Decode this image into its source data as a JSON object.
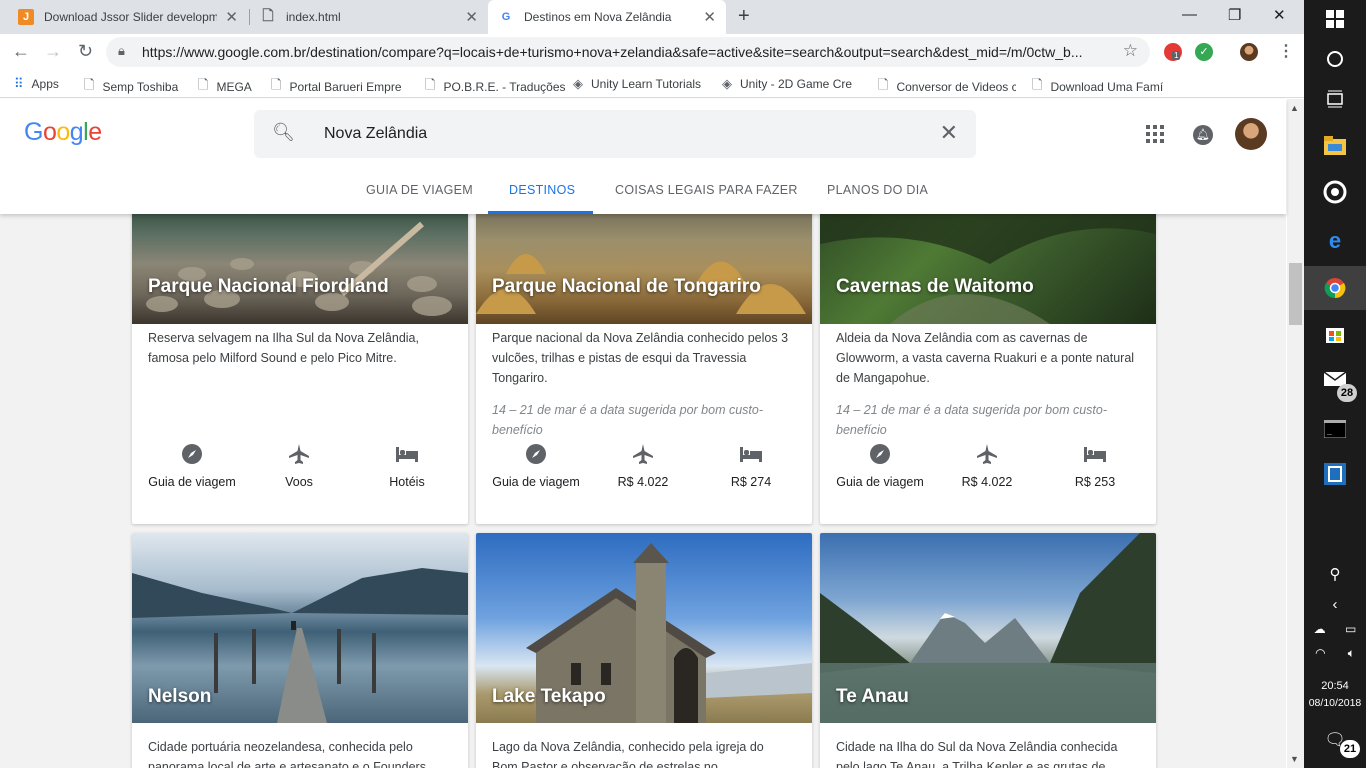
{
  "browser": {
    "tabs": [
      {
        "title": "Download Jssor Slider developm",
        "favicon": "J"
      },
      {
        "title": "index.html",
        "favicon": "doc-icon"
      },
      {
        "title": "Destinos em Nova Zelândia",
        "favicon": "G"
      }
    ],
    "url": "https://www.google.com.br/destination/compare?q=locais+de+turismo+nova+zelandia&safe=active&site=search&output=search&dest_mid=/m/0ctw_b...",
    "ext_badge": "1",
    "bookmarks": [
      "Apps",
      "Semp Toshiba",
      "MEGA",
      "Portal Barueri Empre",
      "PO.B.R.E. - Traduções",
      "Unity Learn Tutorials",
      "Unity - 2D Game Cre",
      "Conversor de Videos c",
      "Download Uma Famí"
    ]
  },
  "header": {
    "logo": [
      "G",
      "o",
      "o",
      "g",
      "l",
      "e"
    ],
    "logo_colors": [
      "#4285F4",
      "#EA4335",
      "#FBBC05",
      "#4285F4",
      "#34A853",
      "#EA4335"
    ],
    "search_query": "Nova Zelândia",
    "tabs": [
      "GUIA DE VIAGEM",
      "DESTINOS",
      "COISAS LEGAIS PARA FAZER",
      "PLANOS DO DIA"
    ],
    "active_tab": "DESTINOS",
    "accent": "#1a73e8"
  },
  "cards_row1": [
    {
      "name": "Parque Nacional Fiordland",
      "desc": "Reserva selvagem na Ilha Sul da Nova Zelândia, famosa pelo Milford Sound e pelo Pico Mitre.",
      "hint": "",
      "actions": [
        "Guia de viagem",
        "Voos",
        "Hotéis"
      ]
    },
    {
      "name": "Parque Nacional de Tongariro",
      "desc": "Parque nacional da Nova Zelândia conhecido pelos 3 vulcões, trilhas e pistas de esqui da Travessia Tongariro.",
      "hint": "14 – 21 de mar é a data sugerida por bom custo-benefício",
      "actions": [
        "Guia de viagem",
        "R$ 4.022",
        "R$ 274"
      ]
    },
    {
      "name": "Cavernas de Waitomo",
      "desc": "Aldeia da Nova Zelândia com as cavernas de Glowworm, a vasta caverna Ruakuri e a ponte natural de Mangapohue.",
      "hint": "14 – 21 de mar é a data sugerida por bom custo-benefício",
      "actions": [
        "Guia de viagem",
        "R$ 4.022",
        "R$ 253"
      ]
    }
  ],
  "cards_row2": [
    {
      "name": "Nelson",
      "desc": "Cidade portuária neozelandesa, conhecida pelo panorama local de arte e artesanato e o Founders"
    },
    {
      "name": "Lake Tekapo",
      "desc": "Lago da Nova Zelândia, conhecido pela igreja do Bom Pastor e observação de estrelas no"
    },
    {
      "name": "Te Anau",
      "desc": "Cidade na Ilha do Sul da Nova Zelândia conhecida pelo lago Te Anau, a Trilha Kepler e as grutas de"
    }
  ],
  "taskbar": {
    "mail_badge": "28",
    "time": "20:54",
    "date": "08/10/2018",
    "notif_badge": "21"
  }
}
